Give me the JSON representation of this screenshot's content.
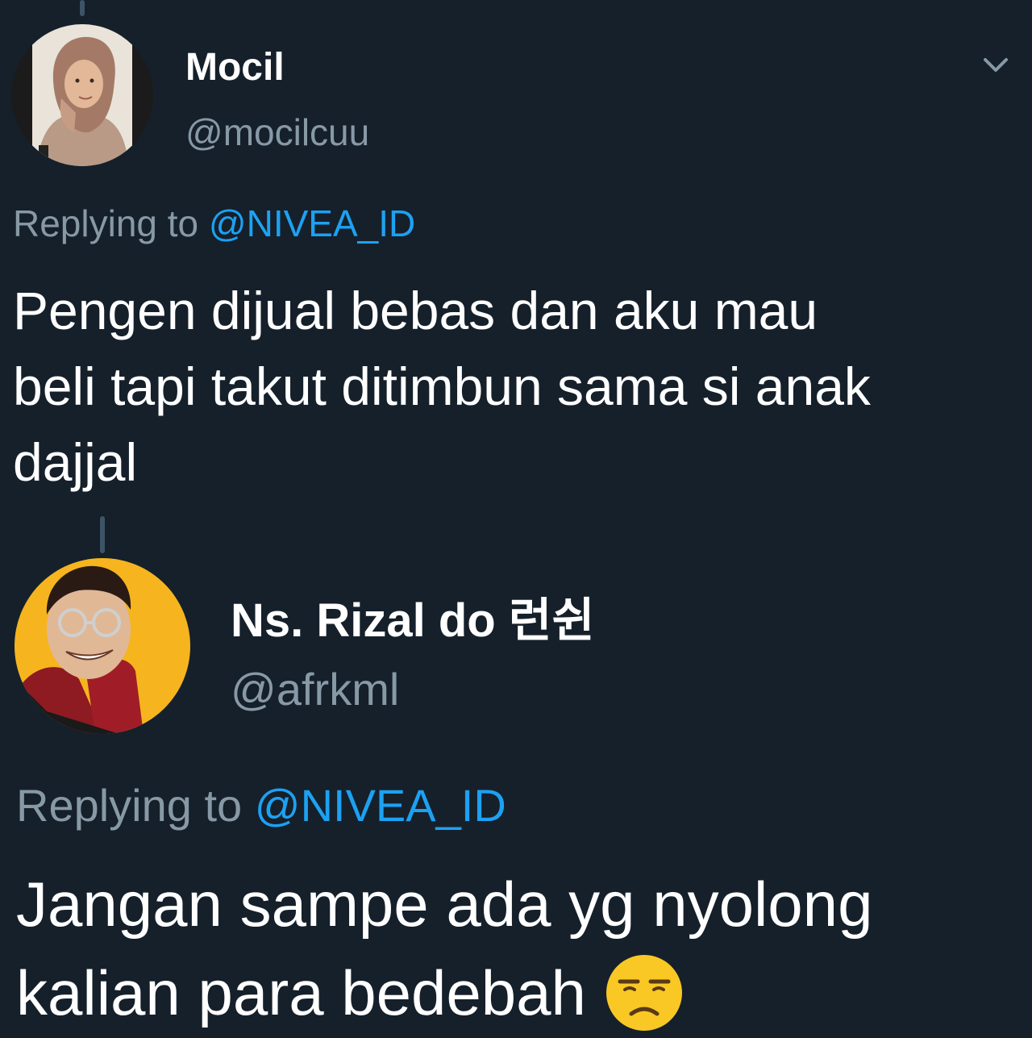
{
  "tweets": [
    {
      "display_name": "Mocil",
      "handle": "@mocilcuu",
      "replying_label": "Replying to",
      "replying_to": "@NIVEA_ID",
      "text_lines": [
        "Pengen dijual bebas dan aku mau",
        "beli tapi takut ditimbun sama si anak",
        "dajjal"
      ]
    },
    {
      "display_name": "Ns. Rizal do 런쉰",
      "handle": "@afrkml",
      "replying_label": "Replying to",
      "replying_to": "@NIVEA_ID",
      "text_lines": [
        "Jangan sampe ada yg nyolong",
        "kalian para bedebah"
      ],
      "trailing_emoji": "unamused-face"
    }
  ],
  "icons": {
    "more_menu": "chevron-down-icon"
  },
  "colors": {
    "background": "#15202b",
    "text": "#ffffff",
    "secondary_text": "#8899a6",
    "mention": "#1da1f2",
    "thread_line": "#3d5466"
  }
}
